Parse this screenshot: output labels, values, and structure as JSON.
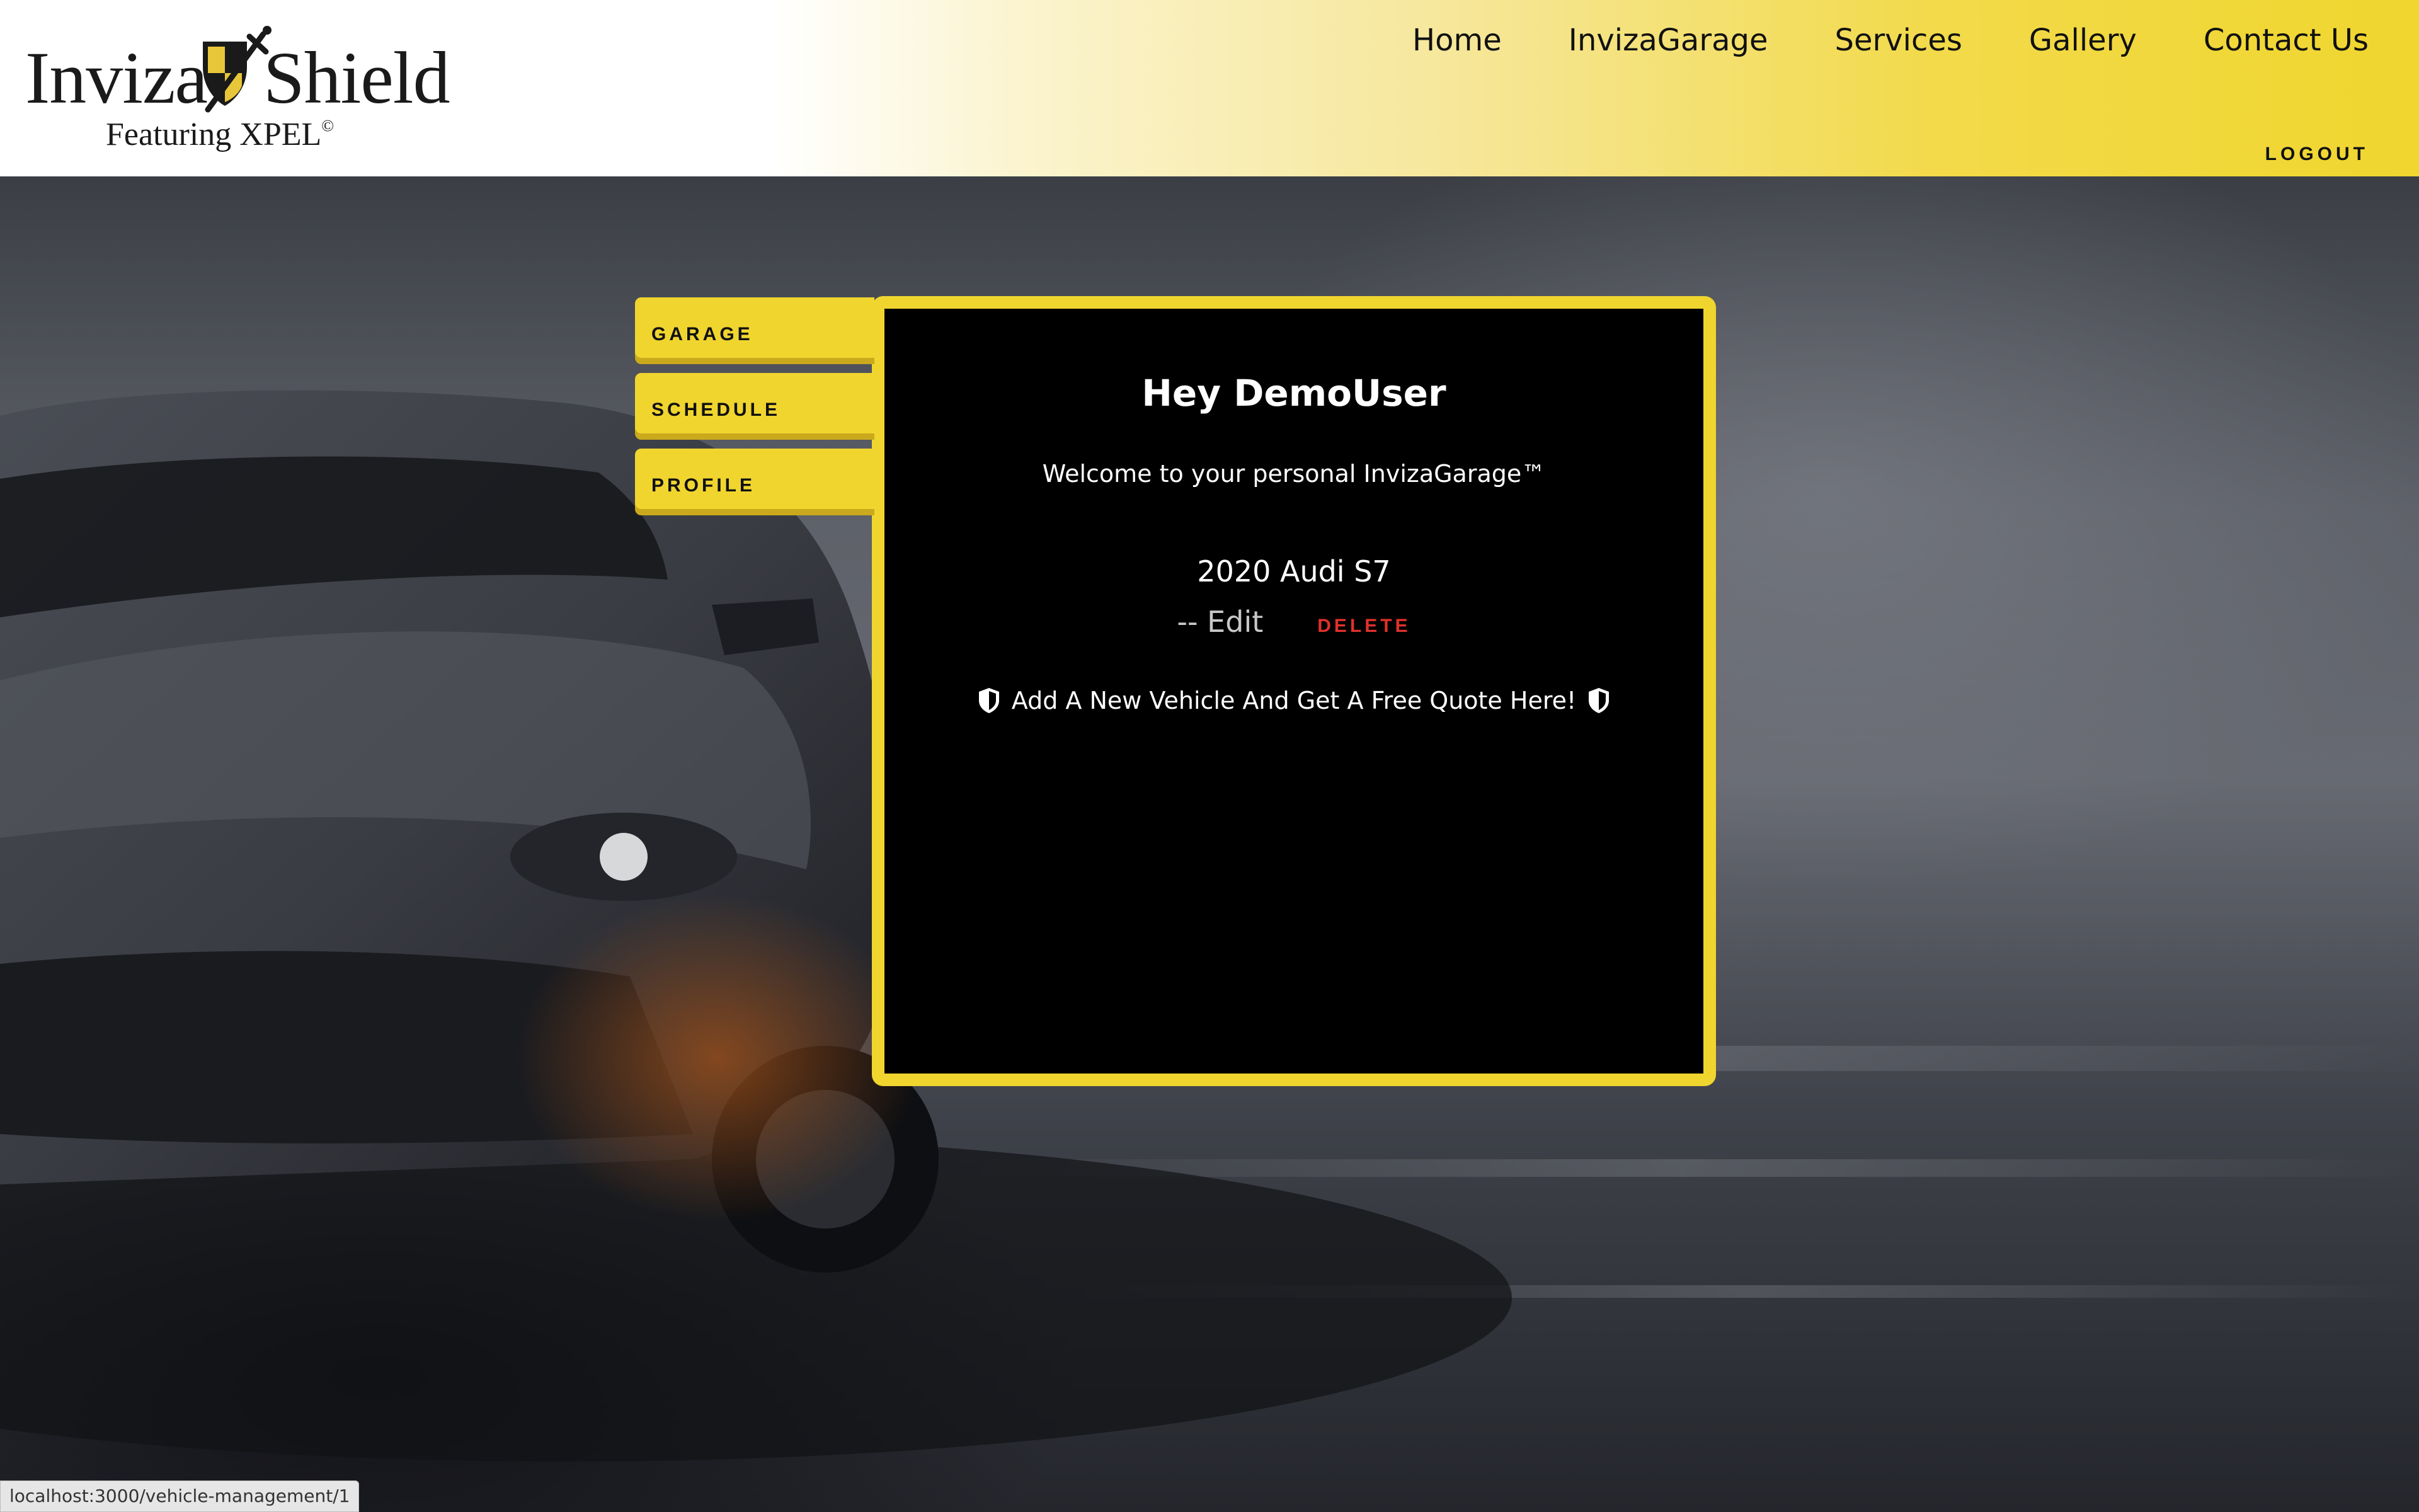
{
  "brand": {
    "name_part1": "Inviza",
    "name_part2": "Shield",
    "subtitle": "Featuring XPEL",
    "subtitle_mark": "©"
  },
  "nav": {
    "items": [
      {
        "label": "Home"
      },
      {
        "label": "InvizaGarage"
      },
      {
        "label": "Services"
      },
      {
        "label": "Gallery"
      },
      {
        "label": "Contact Us"
      }
    ],
    "logout_label": "LOGOUT"
  },
  "sidebar": {
    "tabs": [
      {
        "label": "GARAGE"
      },
      {
        "label": "SCHEDULE"
      },
      {
        "label": "PROFILE"
      }
    ]
  },
  "garage": {
    "greeting": "Hey DemoUser",
    "welcome": "Welcome to your personal InvizaGarage™",
    "vehicle": {
      "name": "2020 Audi S7",
      "edit_label": "-- Edit",
      "delete_label": "DELETE"
    },
    "add_vehicle_label": "Add A New Vehicle And Get A Free Quote Here!"
  },
  "statusbar": {
    "url": "localhost:3000/vehicle-management/1"
  },
  "colors": {
    "accent_yellow": "#f0d52f",
    "panel_bg": "#000000",
    "delete_red": "#e0312b"
  }
}
